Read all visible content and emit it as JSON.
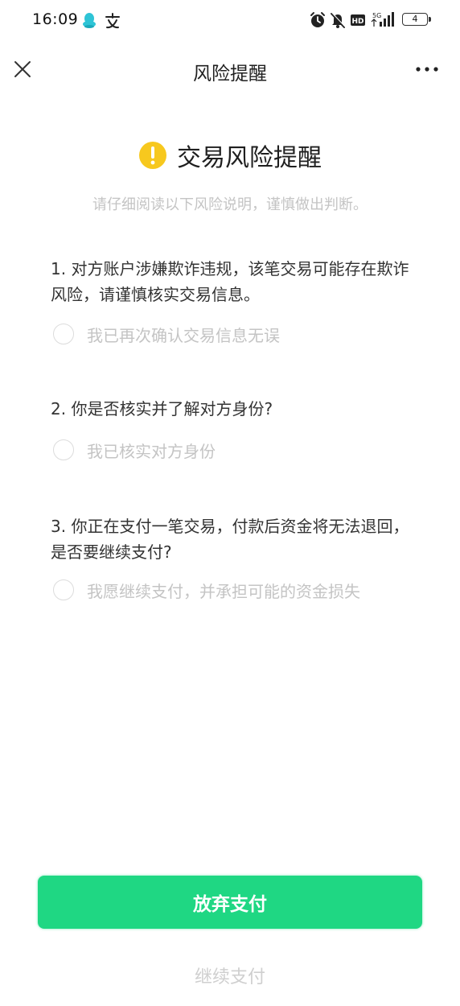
{
  "status_bar": {
    "time": "16:09",
    "battery": "4",
    "network": "5G",
    "hd_label": "HD"
  },
  "nav": {
    "title": "风险提醒"
  },
  "header": {
    "title": "交易风险提醒",
    "subtitle": "请仔细阅读以下风险说明，谨慎做出判断。"
  },
  "questions": [
    {
      "text": "1. 对方账户涉嫌欺诈违规，该笔交易可能存在欺诈风险，请谨慎核实交易信息。",
      "option": "我已再次确认交易信息无误"
    },
    {
      "text": "2. 你是否核实并了解对方身份?",
      "option": "我已核实对方身份"
    },
    {
      "text": "3. 你正在支付一笔交易，付款后资金将无法退回，是否要继续支付?",
      "option": "我愿继续支付，并承担可能的资金损失"
    }
  ],
  "buttons": {
    "primary_label": "放弃支付",
    "secondary_label": "继续支付"
  },
  "colors": {
    "accent": "#1fd783",
    "warning": "#f7c81e",
    "muted_text": "#c4c4c4"
  }
}
